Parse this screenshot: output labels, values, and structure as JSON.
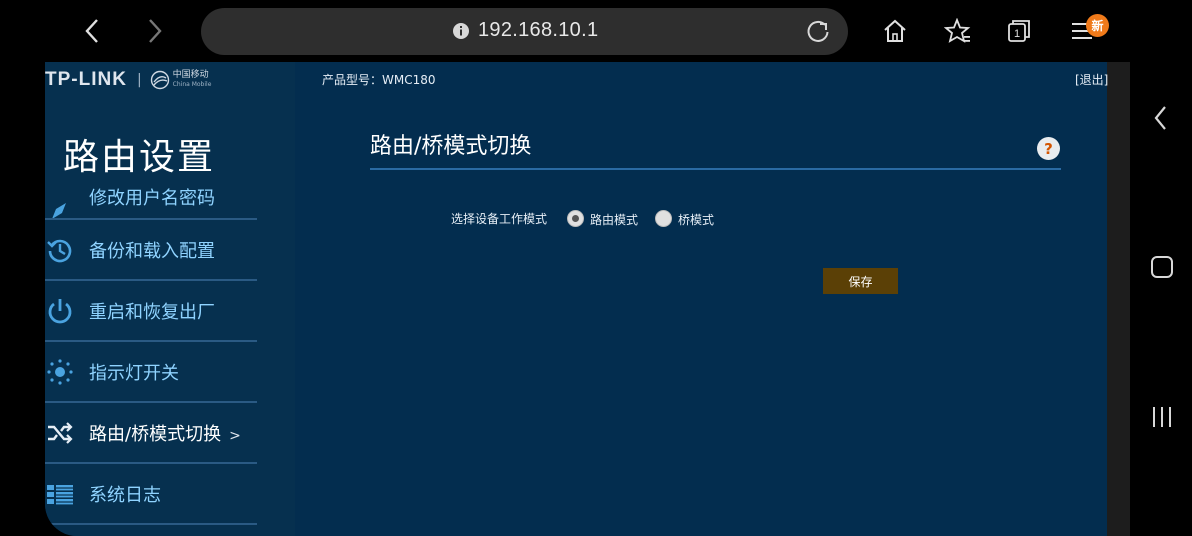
{
  "browser": {
    "url": "192.168.10.1",
    "badge": "新"
  },
  "header": {
    "logo_brand": "TP-LINK",
    "logo_sep": "|",
    "logo_partner_cn": "中国移动",
    "logo_partner_en": "China Mobile",
    "model_label": "产品型号：WMC180",
    "logout_label": "[退出]"
  },
  "sidebar": {
    "section_title": "路由设置",
    "items": [
      {
        "label": "修改用户名密码",
        "icon": "pencil-icon"
      },
      {
        "label": "备份和载入配置",
        "icon": "history-icon"
      },
      {
        "label": "重启和恢复出厂",
        "icon": "power-icon"
      },
      {
        "label": "指示灯开关",
        "icon": "light-icon"
      },
      {
        "label": "路由/桥模式切换",
        "icon": "shuffle-icon",
        "active": true,
        "arrow": ">"
      },
      {
        "label": "系统日志",
        "icon": "list-icon"
      }
    ]
  },
  "main": {
    "title": "路由/桥模式切换",
    "help": "?",
    "mode_label": "选择设备工作模式",
    "options": [
      {
        "label": "路由模式",
        "checked": true
      },
      {
        "label": "桥模式",
        "checked": false
      }
    ],
    "save_label": "保存"
  },
  "colors": {
    "page_bg": "#032a48",
    "menu_text": "#8fd3ff",
    "save_button": "#5b4006",
    "badge": "#f07a1a"
  }
}
